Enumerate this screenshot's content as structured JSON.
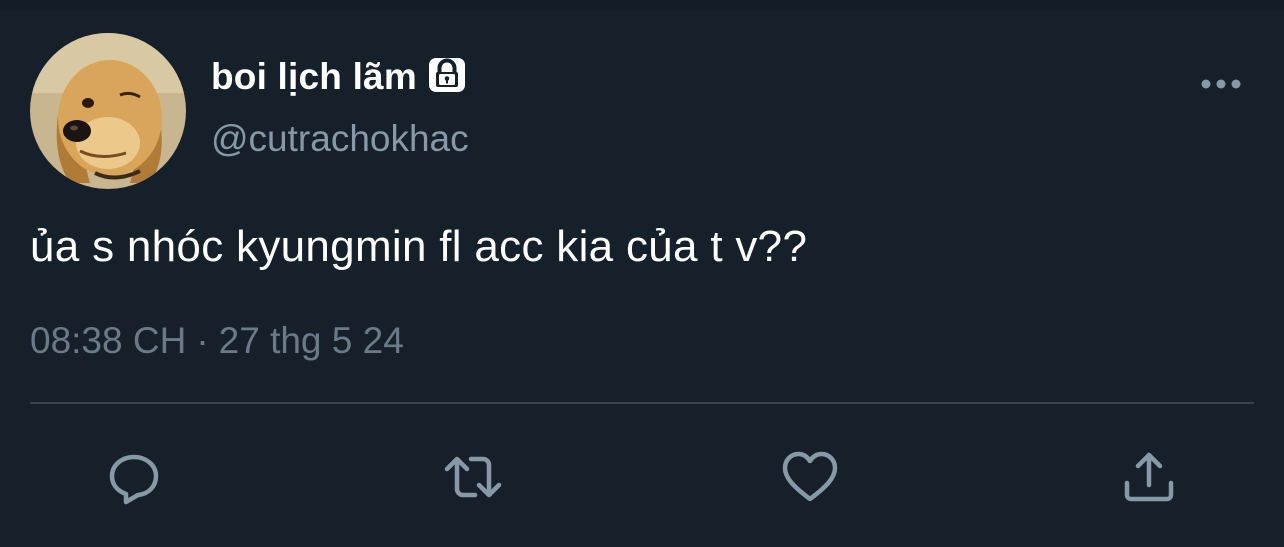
{
  "tweet": {
    "display_name": "boi lịch lãm",
    "handle": "@cutrachokhac",
    "text": "ủa s nhóc kyungmin fl acc kia của t v??",
    "time": "08:38 CH",
    "separator": "·",
    "date": "27 thg 5 24",
    "protected_icon": "lock-icon",
    "avatar_icon": "golden-retriever-puppy-avatar"
  },
  "actions": [
    {
      "name": "reply",
      "icon": "reply-icon"
    },
    {
      "name": "retweet",
      "icon": "retweet-icon"
    },
    {
      "name": "like",
      "icon": "heart-icon"
    },
    {
      "name": "share",
      "icon": "share-icon"
    }
  ],
  "colors": {
    "background": "#15202b",
    "text_primary": "#ffffff",
    "text_secondary": "#8899a6",
    "divider": "#38444d",
    "icon": "#8899a6"
  }
}
